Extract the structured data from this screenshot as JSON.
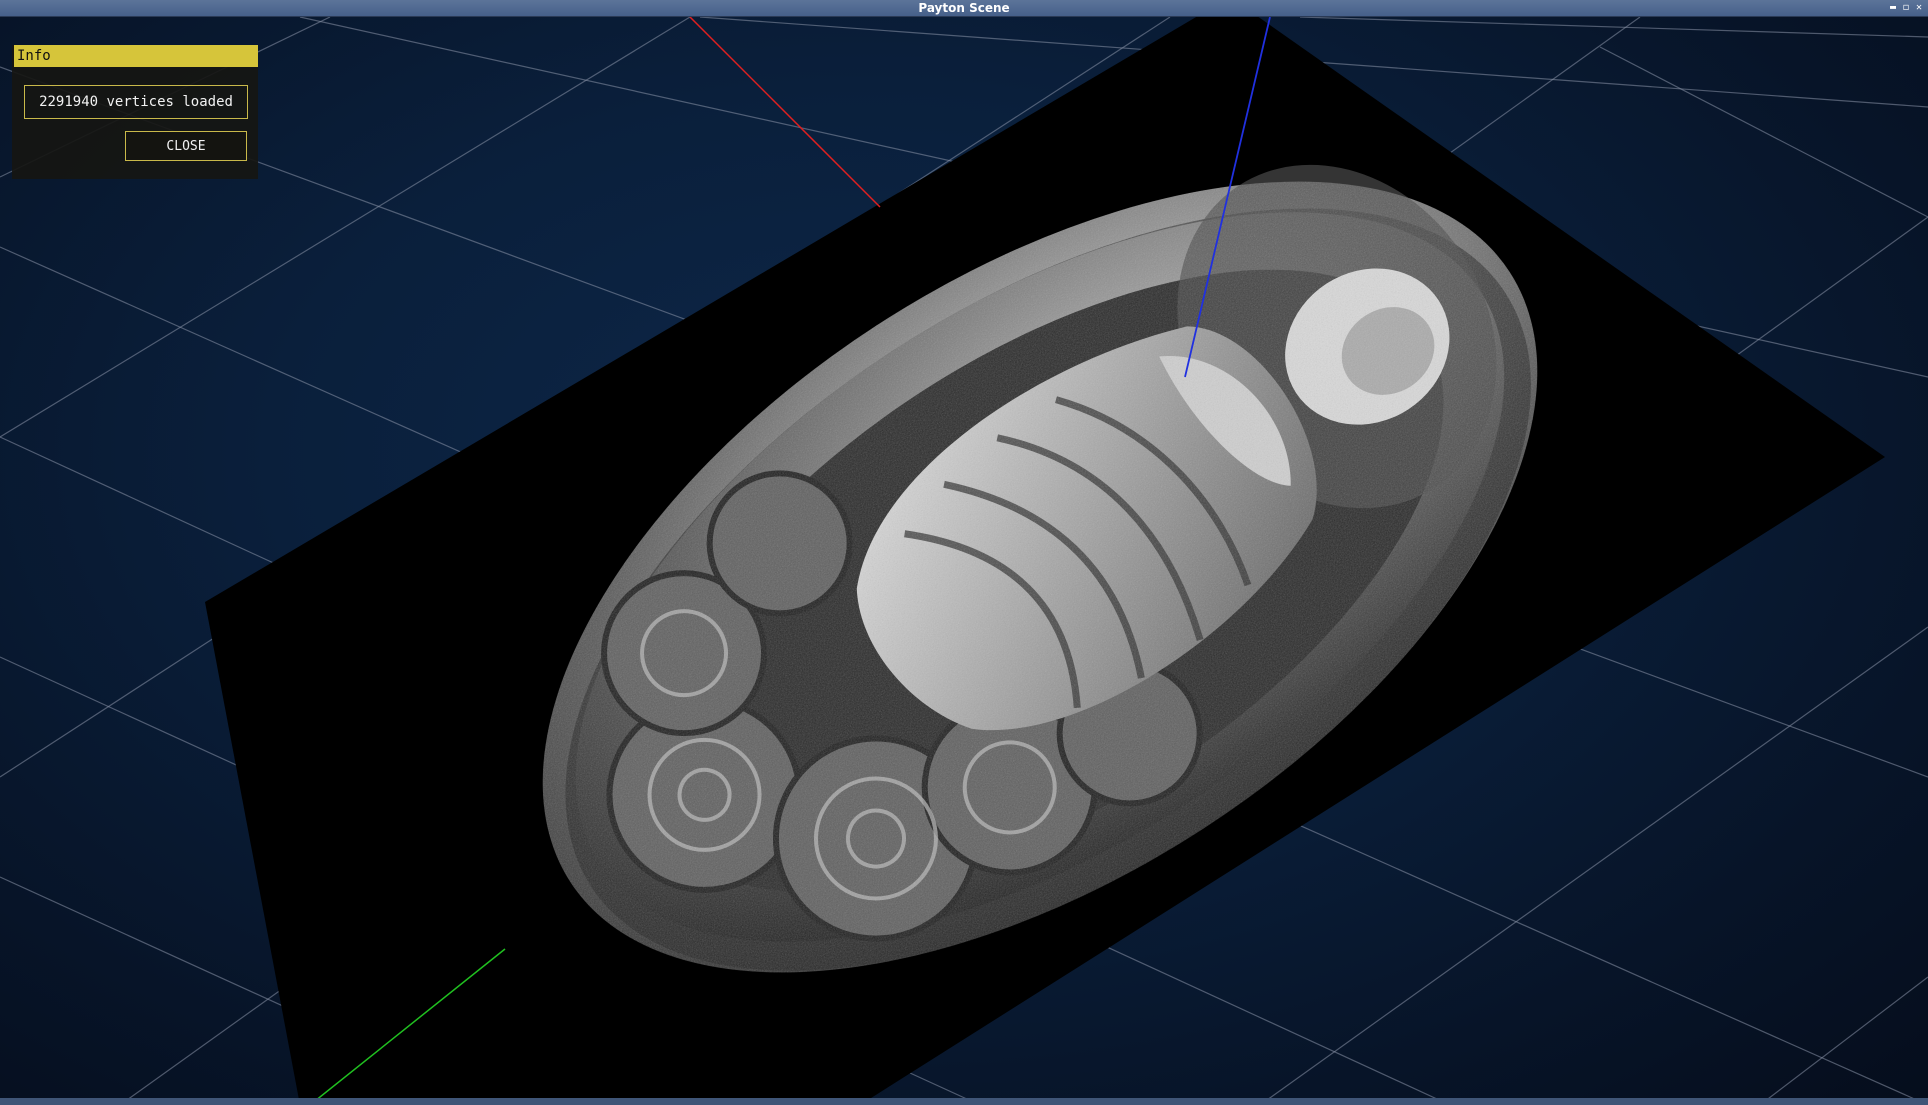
{
  "window": {
    "title": "Payton Scene",
    "controls": {
      "minimize": "▬",
      "maximize": "◻",
      "close": "✕"
    }
  },
  "info_panel": {
    "title": "Info",
    "message": "2291940 vertices loaded",
    "close_label": "CLOSE"
  },
  "scene": {
    "object": "relief-medallion",
    "axes": {
      "x_color": "#e02020",
      "y_color": "#20c020",
      "z_color": "#2020e0"
    },
    "grid_color": "#9aa4b4",
    "background_color": "#0a1f3b",
    "accent_color": "#d6c53a"
  }
}
